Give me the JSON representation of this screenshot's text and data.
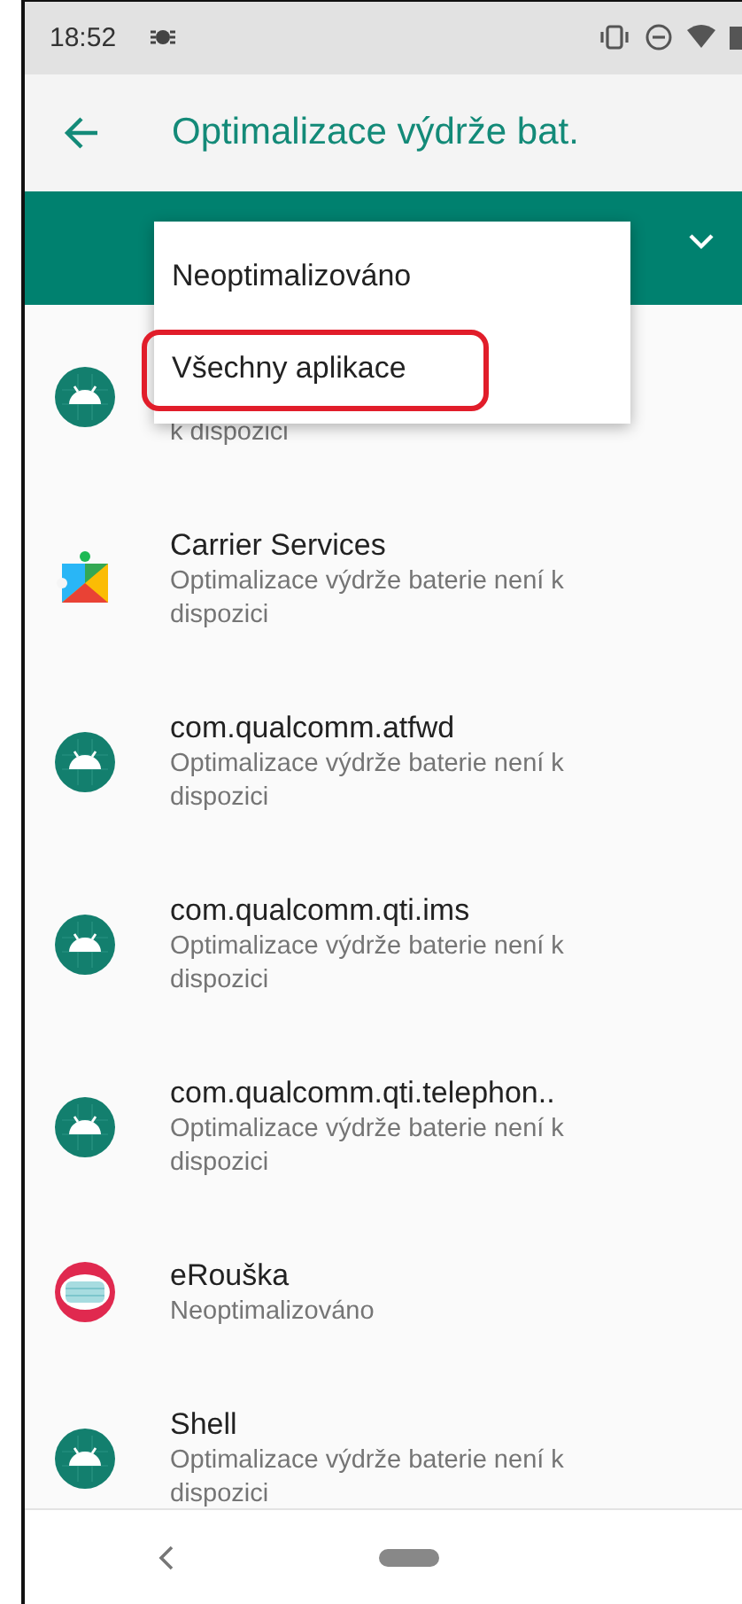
{
  "status_bar": {
    "time": "18:52"
  },
  "app_bar": {
    "title": "Optimalizace výdrže bat."
  },
  "filter_menu": {
    "items": [
      {
        "label": "Neoptimalizováno",
        "highlighted": false
      },
      {
        "label": "Všechny aplikace",
        "highlighted": true
      }
    ]
  },
  "apps": [
    {
      "kind": "robot",
      "subtitle": "k dispozici"
    },
    {
      "kind": "puzzle",
      "title": "Carrier Services",
      "subtitle": "Optimalizace výdrže baterie není k dispozici"
    },
    {
      "kind": "robot",
      "title": "com.qualcomm.atfwd",
      "subtitle": "Optimalizace výdrže baterie není k dispozici"
    },
    {
      "kind": "robot",
      "title": "com.qualcomm.qti.ims",
      "subtitle": "Optimalizace výdrže baterie není k dispozici"
    },
    {
      "kind": "robot",
      "title": "com.qualcomm.qti.telephon..",
      "subtitle": "Optimalizace výdrže baterie není k dispozici"
    },
    {
      "kind": "mask",
      "title": "eRouška",
      "subtitle": "Neoptimalizováno"
    },
    {
      "kind": "robot",
      "title": "Shell",
      "subtitle": "Optimalizace výdrže baterie není k dispozici"
    }
  ]
}
